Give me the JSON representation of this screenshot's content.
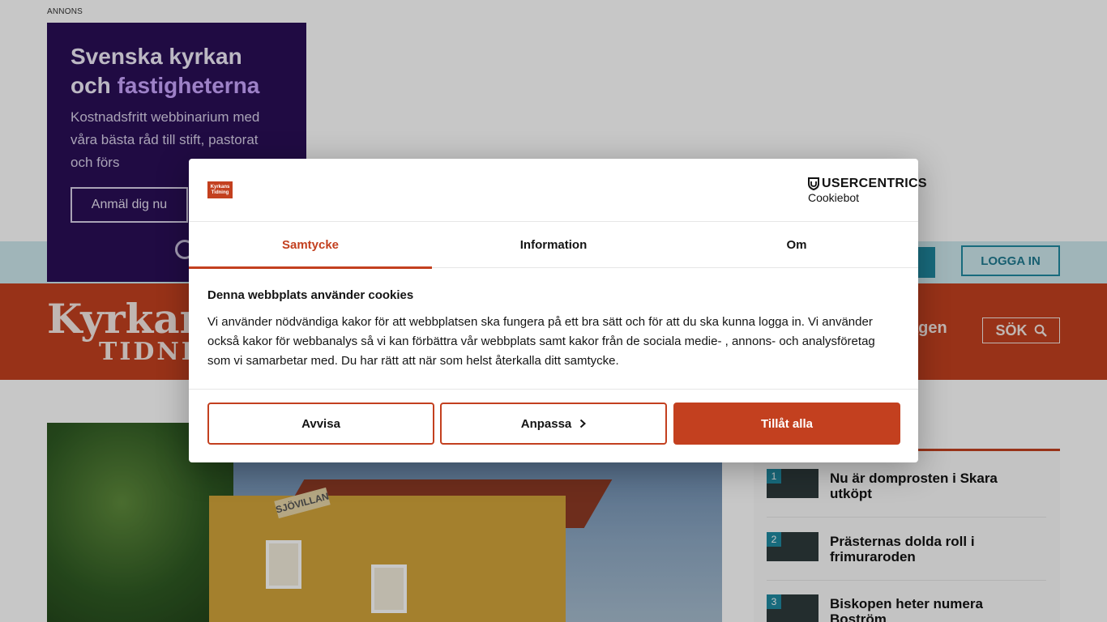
{
  "page": {
    "ad": {
      "label": "ANNONS",
      "title_line1": "Svenska kyrkan",
      "title_and": "och ",
      "title_accent": "fastigheterna",
      "text": "Kostnadsfritt webbinarium med våra bästa råd till stift, pastorat och förs",
      "button": "Anmäl dig nu"
    },
    "topbar": {
      "login": "LOGGA IN"
    },
    "header": {
      "logo_line1": "Kyrkan",
      "logo_line2": "TIDNI",
      "nav_partial": "agen",
      "search": "SÖK"
    },
    "hero": {
      "sign": "SJÖVILLAN"
    },
    "most_read": [
      {
        "rank": "1",
        "title": "Nu är domprosten i Skara utköpt"
      },
      {
        "rank": "2",
        "title": "Prästernas dolda roll i frimuraroden"
      },
      {
        "rank": "3",
        "title": "Biskopen heter numera Boström"
      }
    ]
  },
  "dialog": {
    "site_logo": "Kyrkans Tidning",
    "provider": "USERCENTRICS",
    "provider_sub": "Cookiebot",
    "tabs": [
      {
        "label": "Samtycke",
        "active": true
      },
      {
        "label": "Information",
        "active": false
      },
      {
        "label": "Om",
        "active": false
      }
    ],
    "heading": "Denna webbplats använder cookies",
    "body": "Vi använder nödvändiga kakor för att webbplatsen ska fungera på ett bra sätt och för att du ska kunna logga in. Vi använder också kakor för webbanalys så vi kan förbättra vår webbplats samt kakor från de sociala medie- , annons- och analysföretag som vi samarbetar med. Du har rätt att när som helst återkalla ditt samtycke.",
    "buttons": {
      "reject": "Avvisa",
      "customize": "Anpassa",
      "accept": "Tillåt alla"
    }
  },
  "colors": {
    "brand": "#c3401f",
    "teal": "#1f8aa0",
    "ad_bg": "#2a0f57"
  }
}
